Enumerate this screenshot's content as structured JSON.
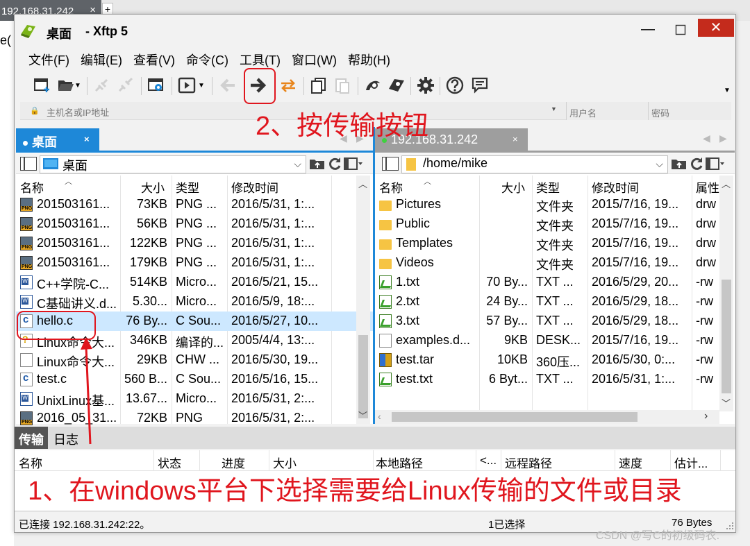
{
  "background": {
    "browser_tab": "192.168.31.242",
    "tab_close": "×",
    "tab_plus": "+",
    "left_fragment": "e("
  },
  "window": {
    "title_location": "桌面",
    "title_app": "- Xftp 5",
    "min_glyph": "—",
    "close_glyph": "✕"
  },
  "menu": [
    "文件(F)",
    "编辑(E)",
    "查看(V)",
    "命令(C)",
    "工具(T)",
    "窗口(W)",
    "帮助(H)"
  ],
  "address": {
    "host_placeholder": "主机名或IP地址",
    "user_placeholder": "用户名",
    "password_placeholder": "密码"
  },
  "left_pane": {
    "tab_label": "桌面",
    "path": "桌面",
    "columns": [
      "名称",
      "大小",
      "类型",
      "修改时间"
    ],
    "rows": [
      {
        "icon": "png",
        "name": "201503161...",
        "size": "73KB",
        "type": "PNG ...",
        "mtime": "2016/5/31, 1:..."
      },
      {
        "icon": "png",
        "name": "201503161...",
        "size": "56KB",
        "type": "PNG ...",
        "mtime": "2016/5/31, 1:..."
      },
      {
        "icon": "png",
        "name": "201503161...",
        "size": "122KB",
        "type": "PNG ...",
        "mtime": "2016/5/31, 1:..."
      },
      {
        "icon": "png",
        "name": "201503161...",
        "size": "179KB",
        "type": "PNG ...",
        "mtime": "2016/5/31, 1:..."
      },
      {
        "icon": "doc",
        "name": "C++学院-C...",
        "size": "514KB",
        "type": "Micro...",
        "mtime": "2016/5/21, 15..."
      },
      {
        "icon": "doc",
        "name": "C基础讲义.d...",
        "size": "5.30...",
        "type": "Micro...",
        "mtime": "2016/5/9, 18:..."
      },
      {
        "icon": "c",
        "name": "hello.c",
        "size": "76 By...",
        "type": "C Sou...",
        "mtime": "2016/5/27, 10...",
        "selected": true
      },
      {
        "icon": "chm",
        "name": "Linux命令大...",
        "size": "346KB",
        "type": "编译的...",
        "mtime": "2005/4/4, 13:..."
      },
      {
        "icon": "blank",
        "name": "Linux命令大...",
        "size": "29KB",
        "type": "CHW ...",
        "mtime": "2016/5/30, 19..."
      },
      {
        "icon": "c",
        "name": "test.c",
        "size": "560 B...",
        "type": "C Sou...",
        "mtime": "2016/5/16, 15..."
      },
      {
        "icon": "doc",
        "name": "UnixLinux基...",
        "size": "13.67...",
        "type": "Micro...",
        "mtime": "2016/5/31, 2:..."
      },
      {
        "icon": "png",
        "name": "2016_05_31...",
        "size": "72KB",
        "type": "PNG",
        "mtime": "2016/5/31, 2:..."
      }
    ]
  },
  "right_pane": {
    "tab_label": "192.168.31.242",
    "path": "/home/mike",
    "columns": [
      "名称",
      "大小",
      "类型",
      "修改时间",
      "属性"
    ],
    "rows": [
      {
        "icon": "folder",
        "name": "Pictures",
        "size": "",
        "type": "文件夹",
        "mtime": "2015/7/16, 19...",
        "attr": "drw"
      },
      {
        "icon": "folder",
        "name": "Public",
        "size": "",
        "type": "文件夹",
        "mtime": "2015/7/16, 19...",
        "attr": "drw"
      },
      {
        "icon": "folder",
        "name": "Templates",
        "size": "",
        "type": "文件夹",
        "mtime": "2015/7/16, 19...",
        "attr": "drw"
      },
      {
        "icon": "folder",
        "name": "Videos",
        "size": "",
        "type": "文件夹",
        "mtime": "2015/7/16, 19...",
        "attr": "drw"
      },
      {
        "icon": "txt",
        "name": "1.txt",
        "size": "70 By...",
        "type": "TXT ...",
        "mtime": "2016/5/29, 20...",
        "attr": "-rw"
      },
      {
        "icon": "txt",
        "name": "2.txt",
        "size": "24 By...",
        "type": "TXT ...",
        "mtime": "2016/5/29, 18...",
        "attr": "-rw"
      },
      {
        "icon": "txt",
        "name": "3.txt",
        "size": "57 By...",
        "type": "TXT ...",
        "mtime": "2016/5/29, 18...",
        "attr": "-rw"
      },
      {
        "icon": "blank",
        "name": "examples.d...",
        "size": "9KB",
        "type": "DESK...",
        "mtime": "2015/7/16, 19...",
        "attr": "-rw"
      },
      {
        "icon": "tar",
        "name": "test.tar",
        "size": "10KB",
        "type": "360压...",
        "mtime": "2016/5/30, 0:...",
        "attr": "-rw"
      },
      {
        "icon": "txt",
        "name": "test.txt",
        "size": "6 Byt...",
        "type": "TXT ...",
        "mtime": "2016/5/31, 1:...",
        "attr": "-rw"
      }
    ]
  },
  "transfer": {
    "tabs": [
      "传输",
      "日志"
    ],
    "columns": [
      "名称",
      "状态",
      "进度",
      "大小",
      "本地路径",
      "<...",
      "远程路径",
      "速度",
      "估计..."
    ]
  },
  "status": {
    "connection": "已连接 192.168.31.242:22。",
    "selection": "1已选择",
    "size": "76 Bytes"
  },
  "annotations": {
    "step2": "2、按传输按钮",
    "step1": "1、在windows平台下选择需要给Linux传输的文件或目录"
  },
  "watermark": "CSDN @写C的初级码农.",
  "colors": {
    "accent_blue": "#1e88d8",
    "annotation_red": "#e0161e",
    "close_red": "#c42b1c"
  }
}
